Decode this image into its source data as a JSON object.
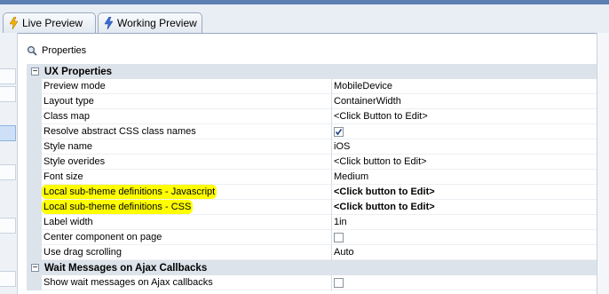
{
  "tabs": [
    {
      "label": "Live Preview",
      "icon": "lightning-icon"
    },
    {
      "label": "Working Preview",
      "icon": "lightning-icon"
    }
  ],
  "properties_panel": {
    "title": "Properties",
    "icon": "magnifier-icon"
  },
  "sections": [
    {
      "title": "UX Properties",
      "rows": [
        {
          "name": "Preview mode",
          "value": "MobileDevice"
        },
        {
          "name": "Layout type",
          "value": "ContainerWidth"
        },
        {
          "name": "Class map",
          "value": "<Click Button to Edit>"
        },
        {
          "name": "Resolve abstract CSS class names",
          "value": "",
          "checkbox": true,
          "checked": true
        },
        {
          "name": "Style name",
          "value": "iOS"
        },
        {
          "name": "Style overides",
          "value": "<Click button to Edit>"
        },
        {
          "name": "Font size",
          "value": "Medium"
        },
        {
          "name": "Local sub-theme definitions - Javascript",
          "value": "<Click button to Edit>",
          "highlighted": true,
          "bold_value": true
        },
        {
          "name": "Local sub-theme definitions - CSS",
          "value": "<Click button to Edit>",
          "highlighted": true,
          "bold_value": true
        },
        {
          "name": "Label width",
          "value": "1in"
        },
        {
          "name": "Center component on page",
          "value": "",
          "checkbox": true,
          "checked": false
        },
        {
          "name": "Use drag scrolling",
          "value": "Auto"
        }
      ]
    },
    {
      "title": "Wait Messages on Ajax Callbacks",
      "rows": [
        {
          "name": "Show wait messages on Ajax callbacks",
          "value": "",
          "checkbox": true,
          "checked": false
        }
      ]
    }
  ],
  "colors": {
    "highlight": "#ffff00",
    "section_bg": "#dde3ea",
    "accent": "#5b7fb0"
  }
}
